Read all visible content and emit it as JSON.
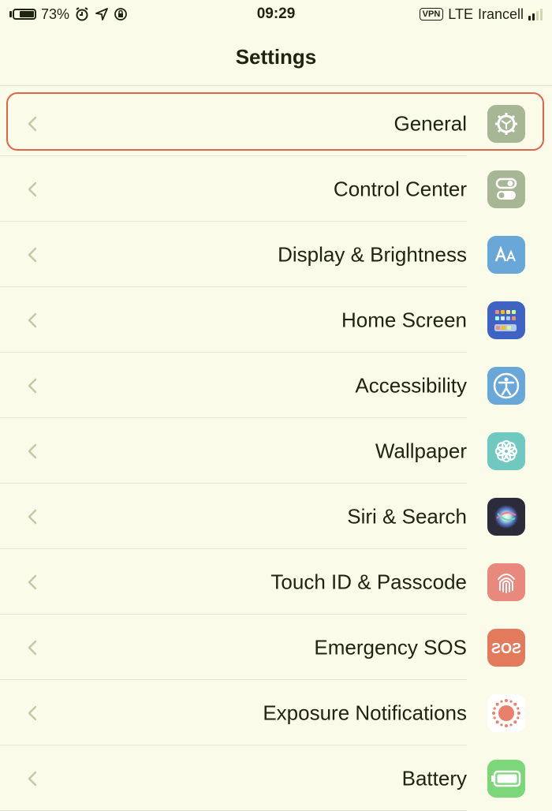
{
  "status_bar": {
    "battery": "73%",
    "time": "09:29",
    "network": "LTE",
    "vpn": "VPN",
    "carrier": "Irancell"
  },
  "nav": {
    "title": "Settings"
  },
  "items": [
    {
      "label": "General",
      "icon": "gear-icon",
      "color": "#a7b796"
    },
    {
      "label": "Control Center",
      "icon": "toggle-switches-icon",
      "color": "#a7b796"
    },
    {
      "label": "Display & Brightness",
      "icon": "text-size-icon",
      "color": "#68a7d8"
    },
    {
      "label": "Home Screen",
      "icon": "home-grid-icon",
      "color": "#3e63c3"
    },
    {
      "label": "Accessibility",
      "icon": "accessibility-person-icon",
      "color": "#68a7d8"
    },
    {
      "label": "Wallpaper",
      "icon": "flower-icon",
      "color": "#6fc9c0"
    },
    {
      "label": "Siri & Search",
      "icon": "siri-orb-icon",
      "color": "#2b2b3a"
    },
    {
      "label": "Touch ID & Passcode",
      "icon": "fingerprint-icon",
      "color": "#e9887c"
    },
    {
      "label": "Emergency SOS",
      "icon": "sos-icon",
      "color": "#e27a5b"
    },
    {
      "label": "Exposure Notifications",
      "icon": "exposure-dots-icon",
      "color": "#ffffff"
    },
    {
      "label": "Battery",
      "icon": "battery-icon",
      "color": "#7cd67a"
    }
  ]
}
